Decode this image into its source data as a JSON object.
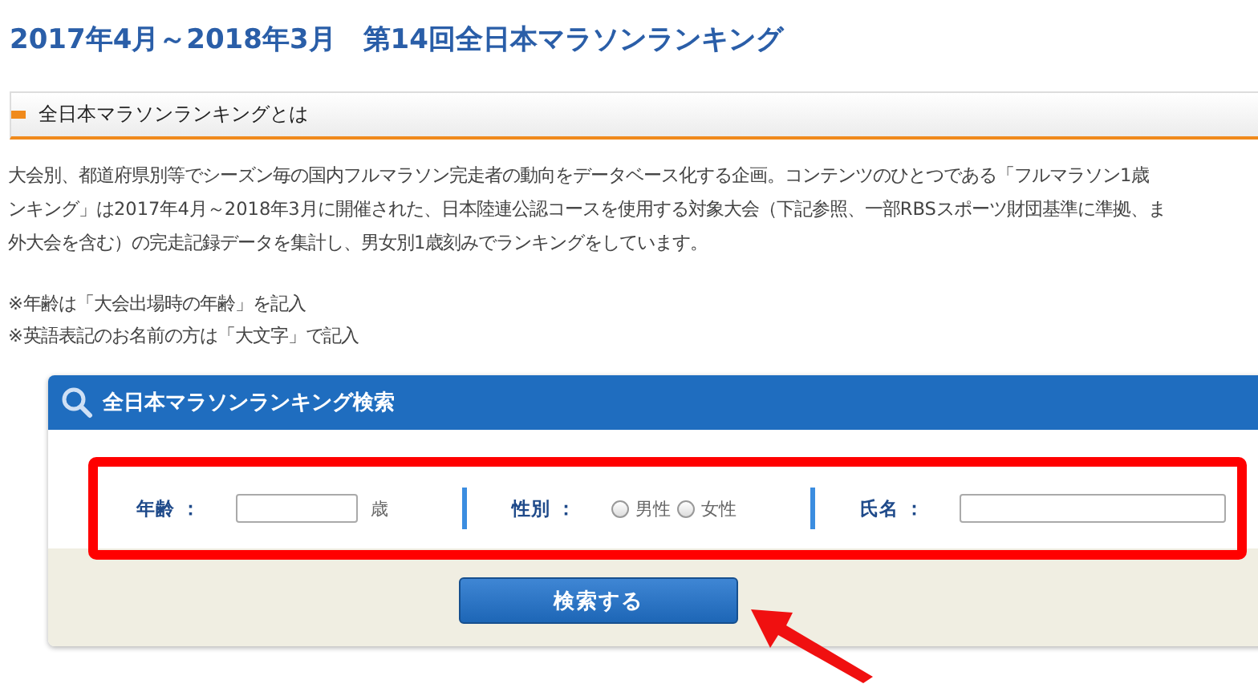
{
  "page_title": "2017年4月～2018年3月　第14回全日本マラソンランキング",
  "section": {
    "title": "全日本マラソンランキングとは"
  },
  "description_lines": [
    "大会別、都道府県別等でシーズン毎の国内フルマラソン完走者の動向をデータベース化する企画。コンテンツのひとつである「フルマラソン1歳",
    "ンキング」は2017年4月～2018年3月に開催された、日本陸連公認コースを使用する対象大会（下記参照、一部RBSスポーツ財団基準に準拠、ま",
    "外大会を含む）の完走記録データを集計し、男女別1歳刻みでランキングをしています。"
  ],
  "notes": [
    "※年齢は「大会出場時の年齢」を記入",
    "※英語表記のお名前の方は「大文字」で記入"
  ],
  "search_panel": {
    "title": "全日本マラソンランキング検索",
    "fields": [
      {
        "kind": "text",
        "label": "年齢 ：",
        "suffix": "歳"
      },
      {
        "kind": "radio",
        "label": "性別 ：",
        "options": [
          {
            "label": "男性",
            "selected": false
          },
          {
            "label": "女性",
            "selected": false
          }
        ]
      },
      {
        "kind": "text",
        "label": "氏名 ："
      }
    ],
    "button": "検索する"
  }
}
